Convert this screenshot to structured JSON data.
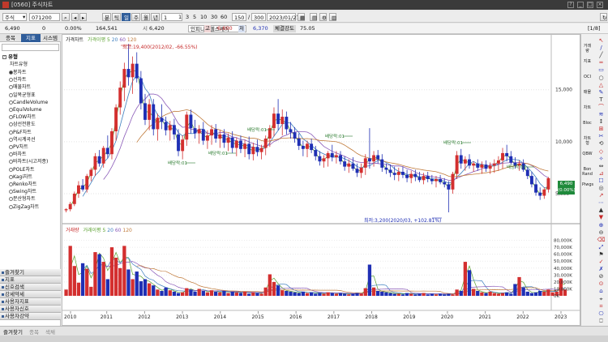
{
  "window": {
    "title": "[0560] 주식차트"
  },
  "toolbar": {
    "category": "주식",
    "code": "071200",
    "modes": [
      "분",
      "틱",
      "일",
      "주",
      "월",
      "년"
    ],
    "active_mode": "일",
    "periods": [
      "1",
      "3",
      "5",
      "10",
      "30",
      "60"
    ],
    "count": "150",
    "total": "300",
    "date": "2023/01/27"
  },
  "info": {
    "stock_name": "인피니트헬스케어",
    "price": "6,490",
    "change": "0",
    "rate": "0.00%",
    "volume": "164,541",
    "open_label": "시",
    "open": "6,420",
    "high_label": "고",
    "high": "6,600",
    "low_label": "저",
    "low": "6,370",
    "strength_label": "체결강도",
    "strength": "75.05",
    "page": "[1/8]"
  },
  "left_panel": {
    "tabs": [
      "종목",
      "지표",
      "시스템"
    ],
    "active_tab": "지표",
    "header": "유형",
    "group": "차트유형",
    "items": [
      "봉차트",
      "선차트",
      "매물차트",
      "일목균형표",
      "CandleVolume",
      "EquiVolume",
      "FLOW차트",
      "삼선전환도",
      "P&F차트",
      "역시계곡선",
      "PV차트",
      "바차트",
      "바차트(시고저종)",
      "POLE차트",
      "Kagi차트",
      "Renko차트",
      "Swing차트",
      "분산형차트",
      "ZigZag차트"
    ],
    "selected": "봉차트",
    "bottom_buttons": [
      "즐겨찾기",
      "지표",
      "신호검색",
      "강세약세",
      "사용자지표",
      "사용자신호",
      "사용자강약"
    ]
  },
  "price_panel": {
    "legend_title": "가격차트",
    "legend_ma": "가격이평",
    "legend_ma_periods": [
      "5",
      "20",
      "60",
      "120"
    ],
    "max_label": "최고:19,400(2012/02, -66.55%)",
    "min_label": "최저:3,200(2020/03, +102.81%)",
    "dividend_label": "배당락:01",
    "current_price": "6,490",
    "current_change": "(0.00%)",
    "y_ticks": [
      "15,000",
      "10,000",
      "5,000"
    ]
  },
  "volume_panel": {
    "legend_title": "거래량",
    "legend_ma": "거래이평",
    "legend_ma_periods": [
      "5",
      "20",
      "60",
      "120"
    ],
    "y_ticks": [
      "80,000K",
      "70,000K",
      "60,000K",
      "50,000K",
      "40,000K",
      "30,000K",
      "20,000K",
      "10,000K",
      "0K"
    ]
  },
  "x_axis": {
    "ticks": [
      "2010",
      "2011",
      "2012",
      "2013",
      "2014",
      "2015",
      "2016",
      "2017",
      "2018",
      "2019",
      "2020",
      "2021",
      "2022",
      "2023"
    ]
  },
  "right_toolbar": {
    "labels": [
      "거래량",
      "지표",
      "OCI",
      "매물",
      "차트",
      "Bloc",
      "차트형",
      "QBW",
      "Bon Rand",
      "Piwgs"
    ]
  },
  "status_bar": {
    "left": "즐겨찾기",
    "tab2": "종목",
    "tab3": "색채"
  },
  "colors": {
    "up": "#d32f2f",
    "down": "#1f2fb4",
    "ma5": "#5aa12f",
    "ma20": "#3d7fbf",
    "ma60": "#8a5ab8",
    "ma120": "#c07a3a",
    "panel_blue": "#2f5d9a"
  },
  "chart_data": {
    "type": "candlestick",
    "granularity": "monthly, approximate",
    "ohlc": [
      [
        3400,
        3200,
        3600,
        3500
      ],
      [
        3500,
        3300,
        4200,
        4000
      ],
      [
        4000,
        3800,
        5200,
        5000
      ],
      [
        5000,
        4600,
        6200,
        5800
      ],
      [
        5800,
        5200,
        6400,
        5400
      ],
      [
        5400,
        5100,
        6900,
        6700
      ],
      [
        6700,
        6200,
        7500,
        7300
      ],
      [
        7300,
        6700,
        8900,
        8600
      ],
      [
        8600,
        7600,
        9200,
        7900
      ],
      [
        7900,
        7500,
        9600,
        9400
      ],
      [
        9400,
        8400,
        10600,
        8800
      ],
      [
        8800,
        8300,
        11300,
        11000
      ],
      [
        11000,
        10100,
        13600,
        13300
      ],
      [
        13300,
        12600,
        15800,
        15200
      ],
      [
        15200,
        13900,
        17600,
        17000
      ],
      [
        17000,
        15400,
        19400,
        16200
      ],
      [
        16200,
        14600,
        18200,
        17500
      ],
      [
        17500,
        15700,
        18600,
        16100
      ],
      [
        16100,
        13100,
        16800,
        13700
      ],
      [
        13700,
        11600,
        14600,
        12100
      ],
      [
        12100,
        11100,
        14100,
        13600
      ],
      [
        13600,
        10600,
        14100,
        11200
      ],
      [
        11200,
        10100,
        12700,
        12300
      ],
      [
        12300,
        11200,
        13600,
        11900
      ],
      [
        11900,
        10600,
        12400,
        11100
      ],
      [
        11100,
        10100,
        12000,
        11600
      ],
      [
        11600,
        10200,
        12200,
        10700
      ],
      [
        10700,
        8600,
        11200,
        9100
      ],
      [
        9100,
        8300,
        10600,
        10200
      ],
      [
        10200,
        9600,
        12900,
        12600
      ],
      [
        12600,
        10800,
        13100,
        11300
      ],
      [
        11300,
        10300,
        12100,
        10800
      ],
      [
        10800,
        9800,
        11600,
        11200
      ],
      [
        11200,
        9700,
        11900,
        10100
      ],
      [
        10100,
        9300,
        11100,
        10600
      ],
      [
        10600,
        9700,
        11600,
        11200
      ],
      [
        11200,
        9900,
        11700,
        10300
      ],
      [
        10300,
        9400,
        11100,
        10700
      ],
      [
        10700,
        9400,
        11200,
        9900
      ],
      [
        9900,
        9100,
        10800,
        10400
      ],
      [
        10400,
        8900,
        11000,
        9400
      ],
      [
        9400,
        8600,
        10400,
        10100
      ],
      [
        10100,
        8900,
        10600,
        9300
      ],
      [
        9300,
        8500,
        10200,
        9800
      ],
      [
        9800,
        8300,
        10500,
        8800
      ],
      [
        8800,
        8200,
        9900,
        9500
      ],
      [
        9500,
        8600,
        10200,
        9000
      ],
      [
        9000,
        8300,
        9700,
        9400
      ],
      [
        9400,
        8700,
        10600,
        10300
      ],
      [
        10300,
        9500,
        11600,
        11300
      ],
      [
        11300,
        10500,
        13300,
        12700
      ],
      [
        12700,
        11100,
        14100,
        11700
      ],
      [
        11700,
        10600,
        13100,
        12400
      ],
      [
        12400,
        10700,
        12900,
        11200
      ],
      [
        11200,
        10300,
        11900,
        10900
      ],
      [
        10900,
        9900,
        11400,
        10300
      ],
      [
        10300,
        9200,
        10800,
        9600
      ],
      [
        9600,
        8600,
        10100,
        9300
      ],
      [
        9300,
        8500,
        10100,
        9800
      ],
      [
        9800,
        8900,
        10300,
        9200
      ],
      [
        9200,
        8200,
        9600,
        8600
      ],
      [
        8600,
        7700,
        9100,
        8100
      ],
      [
        8100,
        7500,
        8700,
        8400
      ],
      [
        8400,
        7600,
        9100,
        8900
      ],
      [
        8900,
        8100,
        9700,
        8500
      ],
      [
        8500,
        7900,
        9100,
        8700
      ],
      [
        8700,
        7800,
        9100,
        8100
      ],
      [
        8100,
        7200,
        8600,
        7600
      ],
      [
        7600,
        7000,
        8300,
        7900
      ],
      [
        7900,
        7200,
        8500,
        7400
      ],
      [
        7400,
        6600,
        7900,
        7000
      ],
      [
        7000,
        6500,
        7900,
        7500
      ],
      [
        7500,
        6800,
        8800,
        8400
      ],
      [
        8400,
        7400,
        11300,
        8100
      ],
      [
        8100,
        7600,
        9100,
        8700
      ],
      [
        8700,
        7900,
        9200,
        8300
      ],
      [
        8300,
        7100,
        8800,
        7500
      ],
      [
        7500,
        6900,
        7900,
        7300
      ],
      [
        7300,
        6600,
        7800,
        7000
      ],
      [
        7000,
        6300,
        7600,
        6800
      ],
      [
        6800,
        6200,
        7500,
        7100
      ],
      [
        7100,
        6500,
        7600,
        6800
      ],
      [
        6800,
        6100,
        7300,
        6500
      ],
      [
        6500,
        6000,
        7200,
        6900
      ],
      [
        6900,
        6200,
        7300,
        6600
      ],
      [
        6600,
        6100,
        7100,
        6300
      ],
      [
        6300,
        5900,
        7000,
        6700
      ],
      [
        6700,
        6100,
        7100,
        6400
      ],
      [
        6400,
        5900,
        6800,
        6200
      ],
      [
        6200,
        5600,
        6700,
        6400
      ],
      [
        6400,
        5900,
        6800,
        6100
      ],
      [
        6100,
        5600,
        6500,
        5900
      ],
      [
        5900,
        3200,
        6200,
        5400
      ],
      [
        5400,
        5000,
        7100,
        6900
      ],
      [
        6900,
        6400,
        9100,
        8700
      ],
      [
        8700,
        7400,
        9300,
        7900
      ],
      [
        7900,
        7200,
        8600,
        8300
      ],
      [
        8300,
        7400,
        8800,
        7700
      ],
      [
        7700,
        7100,
        8100,
        7900
      ],
      [
        7900,
        7200,
        8300,
        7500
      ],
      [
        7500,
        6900,
        8100,
        7800
      ],
      [
        7800,
        7100,
        8200,
        7400
      ],
      [
        7400,
        6900,
        8000,
        7700
      ],
      [
        7700,
        7000,
        8300,
        7900
      ],
      [
        7900,
        7200,
        8600,
        8200
      ],
      [
        8200,
        7400,
        9400,
        8900
      ],
      [
        8900,
        8100,
        9700,
        8600
      ],
      [
        8600,
        7800,
        9100,
        8000
      ],
      [
        8000,
        7400,
        8500,
        7700
      ],
      [
        7700,
        7200,
        8200,
        7900
      ],
      [
        7900,
        7100,
        8300,
        7300
      ],
      [
        7300,
        6400,
        7600,
        6700
      ],
      [
        6700,
        5600,
        7100,
        5900
      ],
      [
        5900,
        4800,
        6500,
        5100
      ],
      [
        5100,
        4400,
        5600,
        4800
      ],
      [
        4800,
        4500,
        5600,
        5400
      ],
      [
        5400,
        5100,
        6600,
        6490
      ]
    ],
    "volume_k": [
      9000,
      72000,
      43000,
      19000,
      47000,
      39000,
      13000,
      63000,
      60000,
      49000,
      24000,
      70000,
      55000,
      40000,
      72000,
      38000,
      24000,
      35000,
      21000,
      24000,
      18000,
      15000,
      9000,
      7000,
      12000,
      8000,
      6000,
      4000,
      5000,
      11000,
      9000,
      6000,
      10000,
      7000,
      5000,
      8000,
      6000,
      5000,
      7000,
      4000,
      6000,
      5000,
      4000,
      6000,
      3000,
      5000,
      4000,
      3000,
      12000,
      31000,
      20000,
      15000,
      8000,
      7000,
      6000,
      5000,
      4000,
      6000,
      4000,
      5000,
      3000,
      4000,
      3000,
      5000,
      4000,
      3000,
      4000,
      3000,
      2000,
      3000,
      4000,
      3000,
      11000,
      45000,
      12000,
      7000,
      6000,
      5000,
      4000,
      3000,
      3000,
      2000,
      4000,
      3000,
      2000,
      3000,
      4000,
      2000,
      3000,
      2000,
      3000,
      2000,
      3000,
      2000,
      9000,
      7000,
      49000,
      37000,
      10000,
      7000,
      5000,
      4000,
      6000,
      4000,
      3000,
      4000,
      5000,
      3000,
      17000,
      27000,
      12000,
      6000,
      4000,
      5000,
      7000,
      6000,
      9000,
      5000,
      6000,
      25000,
      9000
    ],
    "ma_periods": [
      5,
      20,
      60,
      120
    ],
    "y_price_range": [
      2500,
      19500
    ],
    "y_volume_range": [
      0,
      90000
    ],
    "x_range": [
      "2010",
      "2023"
    ]
  }
}
